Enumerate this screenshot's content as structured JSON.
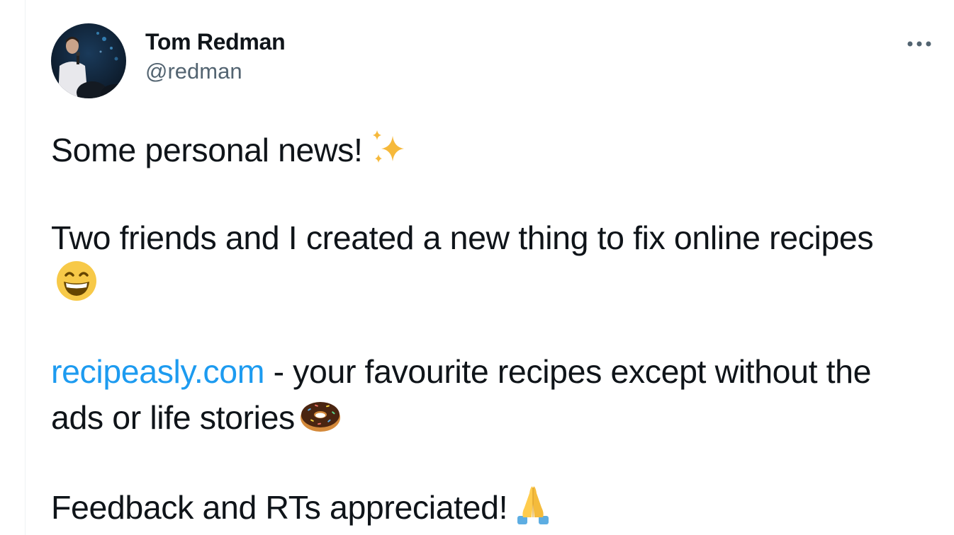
{
  "author": {
    "display_name": "Tom Redman",
    "handle": "@redman",
    "avatar_icon": "avatar-photo"
  },
  "more_icon": "more-options-icon",
  "tweet": {
    "line1_text": "Some personal news!",
    "line1_emoji": "sparkles-emoji",
    "line2_text": "Two friends and I created a new thing to fix online recipes",
    "line2_emoji": "grinning-face-emoji",
    "link_text": "recipeasly.com",
    "line3_text": " - your favourite recipes except without the ads or life stories",
    "line3_emoji": "doughnut-emoji",
    "line4_text": "Feedback and RTs appreciated!",
    "line4_emoji": "folded-hands-emoji"
  },
  "colors": {
    "text": "#0f1419",
    "secondary": "#536471",
    "link": "#1d9bf0"
  }
}
